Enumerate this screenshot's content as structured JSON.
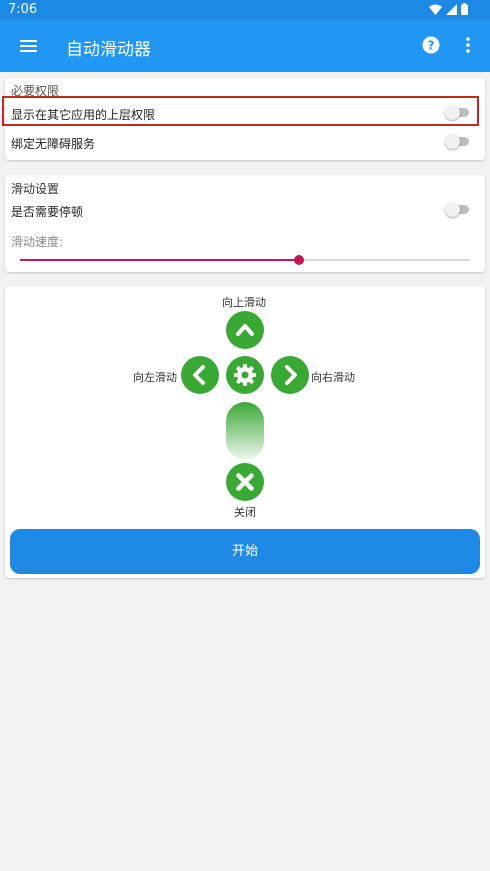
{
  "status_bar": {
    "time": "7:06",
    "icons": [
      "wifi-icon",
      "signal-icon",
      "battery-icon"
    ]
  },
  "app_bar": {
    "title": "自动滑动器",
    "menu_icon": "menu-icon",
    "help_icon": "help-icon",
    "more_icon": "more-vert-icon"
  },
  "permissions": {
    "section_label": "必要权限",
    "overlay_label": "显示在其它应用的上层权限",
    "overlay_enabled": false,
    "accessibility_label": "绑定无障碍服务",
    "accessibility_enabled": false
  },
  "slide_settings": {
    "section_label": "滑动设置",
    "pause_label": "是否需要停顿",
    "pause_enabled": false,
    "speed_label": "滑动速度:",
    "speed_fraction": 0.62
  },
  "controls": {
    "up_label": "向上滑动",
    "left_label": "向左滑动",
    "right_label": "向右滑动",
    "close_label": "关闭",
    "settings_icon": "gear-icon"
  },
  "start_button": {
    "label": "开始"
  },
  "colors": {
    "app_bar": "#2196f3",
    "status_bar": "#1e88e5",
    "accent": "#c2185b",
    "control_green": "#3aa835",
    "highlight": "#c62828"
  }
}
